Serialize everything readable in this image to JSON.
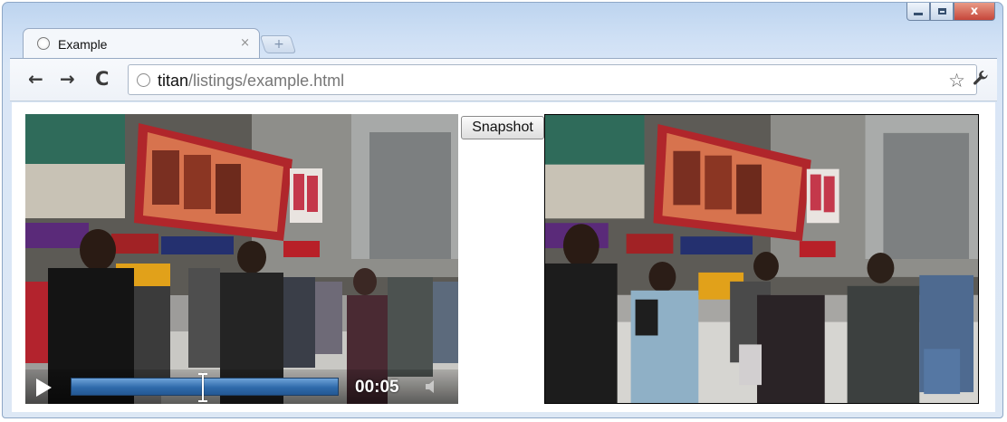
{
  "window": {
    "controls": {
      "minimize": "minimize",
      "maximize": "maximize",
      "close": "x"
    }
  },
  "tab": {
    "title": "Example",
    "close": "×",
    "new_tab": "+"
  },
  "toolbar": {
    "back": "←",
    "forward": "→",
    "reload": "C",
    "url_host": "titan",
    "url_path": "/listings/example.html",
    "star": "☆",
    "wrench": "🔧"
  },
  "page": {
    "video": {
      "time": "00:05",
      "progress": 0.49,
      "icons": [
        "play-icon",
        "volume-icon"
      ]
    },
    "snapshot_label": "Snapshot"
  }
}
